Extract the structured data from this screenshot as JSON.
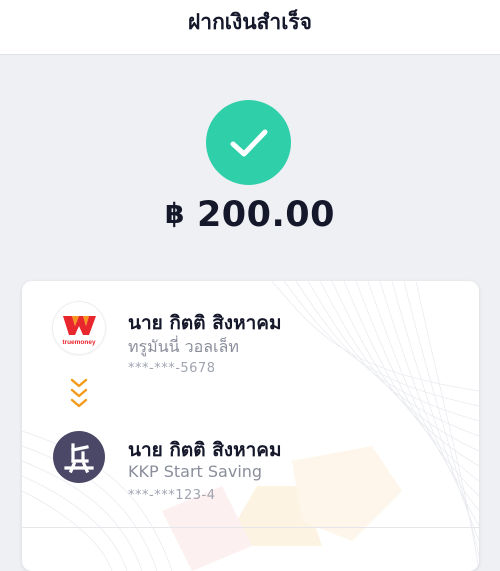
{
  "header": {
    "title": "ฝากเงินสำเร็จ"
  },
  "status": {
    "icon": "checkmark-icon",
    "color": "#2ecfa9"
  },
  "amount": {
    "currency": "฿",
    "value": "200.00"
  },
  "transfer": {
    "from": {
      "logo": "truemoney-logo",
      "logo_text": "truemoney",
      "name": "นาย กิตติ สิงหาคม",
      "service": "ทรูมันนี่ วอลเล็ท",
      "account": "***-***-5678"
    },
    "direction_icon": "chevrons-down-icon",
    "to": {
      "logo": "kkp-logo",
      "name": "นาย กิตติ สิงหาคม",
      "service": "KKP Start Saving",
      "account": "***-***123-4"
    }
  },
  "colors": {
    "accent_green": "#2ecfa9",
    "arrow_orange": "#f39a1b",
    "kkp_purple": "#4a4866",
    "truemoney_red": "#e8262d",
    "truemoney_orange": "#f7941d"
  }
}
